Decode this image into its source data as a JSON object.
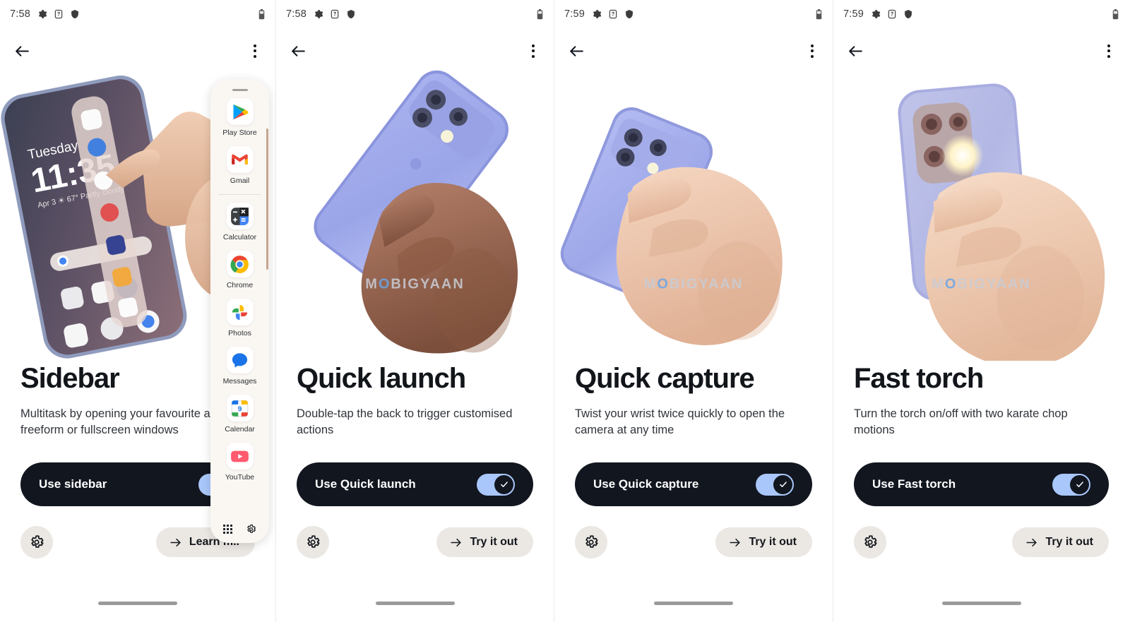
{
  "brand": {
    "watermark": "MOBIGYAAN",
    "accent_blue": "#a9c7fa",
    "pill_dark": "#12161f",
    "button_bg": "#ebe8e4"
  },
  "status_bar": {
    "icons": [
      "gear-icon",
      "help-box-icon",
      "shield-icon"
    ],
    "battery": "battery-icon"
  },
  "app_bar": {
    "back": "back-arrow-icon",
    "overflow": "overflow-menu-icon"
  },
  "screens": [
    {
      "id": "sidebar",
      "time": "7:58",
      "title": "Sidebar",
      "subtitle": "Multitask by opening your favourite apps in freeform or fullscreen windows",
      "toggle_label": "Use sidebar",
      "toggle_on": true,
      "action_label": "Learn m..",
      "hero": "hand-pulling-sidebar-on-phone",
      "overlay": {
        "grip": "drag-handle",
        "apps": [
          {
            "name": "Play Store",
            "icon": "play-store-icon"
          },
          {
            "name": "Gmail",
            "icon": "gmail-icon"
          },
          {
            "name": "Calculator",
            "icon": "calculator-icon",
            "divider_before": true
          },
          {
            "name": "Chrome",
            "icon": "chrome-icon"
          },
          {
            "name": "Photos",
            "icon": "photos-icon"
          },
          {
            "name": "Messages",
            "icon": "messages-icon"
          },
          {
            "name": "Calendar",
            "icon": "calendar-icon"
          },
          {
            "name": "YouTube",
            "icon": "youtube-icon"
          }
        ],
        "footer": [
          "all-apps-grid-icon",
          "settings-gear-icon"
        ]
      },
      "phone_screen": {
        "day": "Tuesday",
        "clock": "11:35",
        "weather": "Apr 3  ☀ 67° Partly cloudy"
      }
    },
    {
      "id": "quick-launch",
      "time": "7:58",
      "title": "Quick launch",
      "subtitle": "Double-tap the back to trigger customised actions",
      "toggle_label": "Use Quick launch",
      "toggle_on": true,
      "action_label": "Try it out",
      "hero": "hand-holding-purple-phone-back"
    },
    {
      "id": "quick-capture",
      "time": "7:59",
      "title": "Quick capture",
      "subtitle": "Twist your wrist twice quickly to open the camera at any time",
      "toggle_label": "Use Quick capture",
      "toggle_on": true,
      "action_label": "Try it out",
      "hero": "hand-twisting-purple-phone"
    },
    {
      "id": "fast-torch",
      "time": "7:59",
      "title": "Fast torch",
      "subtitle": "Turn the torch on/off with two karate chop motions",
      "toggle_label": "Use Fast torch",
      "toggle_on": true,
      "action_label": "Try it out",
      "hero": "hand-holding-phone-with-torch-on"
    }
  ]
}
